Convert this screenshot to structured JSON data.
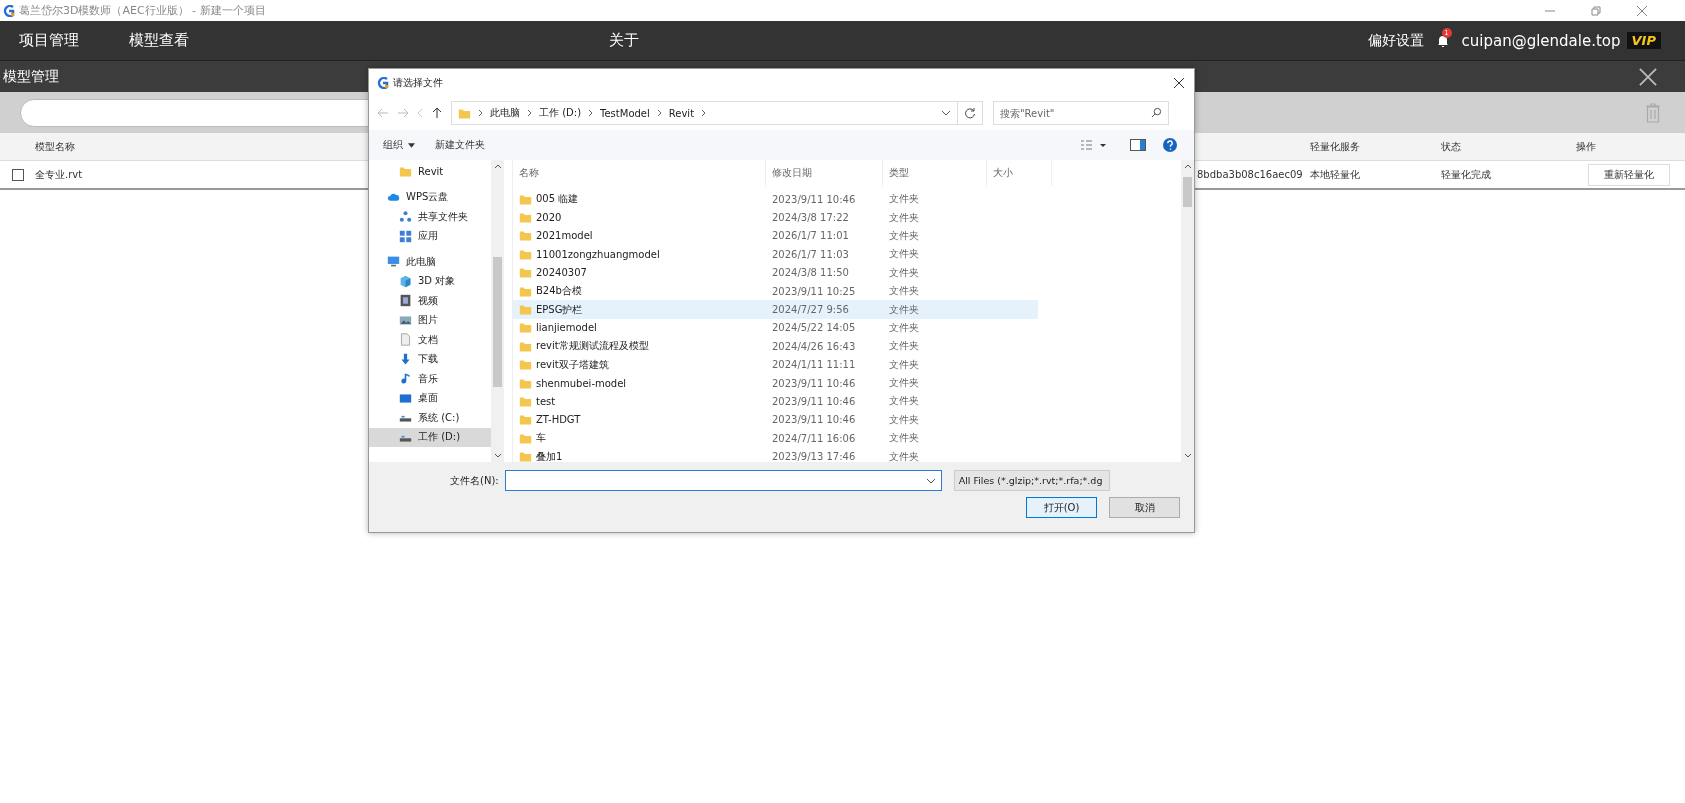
{
  "window": {
    "title": "葛兰岱尔3D模数师（AEC行业版） - 新建一个项目"
  },
  "menu": {
    "items": [
      {
        "label": "项目管理"
      },
      {
        "label": "模型查看"
      },
      {
        "label": "关于"
      }
    ],
    "preferences": "偏好设置",
    "notifications": "1",
    "user": "cuipan@glendale.top",
    "badge": "VIP"
  },
  "panel": {
    "title": "模型管理"
  },
  "table": {
    "columns": [
      "模型名称",
      "轻量化服务",
      "状态",
      "操作"
    ],
    "rows": [
      {
        "checked": false,
        "name": "全专业.rvt",
        "column_2": "8bdba3b08c16aec09",
        "service": "本地轻量化",
        "status": "轻量化完成",
        "action": "重新轻量化"
      }
    ]
  },
  "dialog": {
    "title": "请选择文件",
    "breadcrumb": [
      "此电脑",
      "工作 (D:)",
      "TestModel",
      "Revit"
    ],
    "search": {
      "placeholder": "搜索\"Revit\""
    },
    "toolbar": {
      "organize": "组织",
      "new_folder": "新建文件夹"
    },
    "nav": [
      {
        "children": [
          {
            "label": "Revit",
            "selected": false
          }
        ]
      },
      {
        "label": "WPS云盘",
        "selected": false,
        "children": [
          {
            "label": "共享文件夹",
            "selected": false
          },
          {
            "label": "应用",
            "selected": false
          }
        ]
      },
      {
        "label": "此电脑",
        "selected": false,
        "children": [
          {
            "label": "3D 对象",
            "selected": false
          },
          {
            "label": "视频",
            "selected": false
          },
          {
            "label": "图片",
            "selected": false
          },
          {
            "label": "文档",
            "selected": false
          },
          {
            "label": "下载",
            "selected": false
          },
          {
            "label": "音乐",
            "selected": false
          },
          {
            "label": "桌面",
            "selected": false
          },
          {
            "label": "系统 (C:)",
            "selected": false
          },
          {
            "label": "工作 (D:)",
            "selected": true
          }
        ]
      }
    ],
    "columns": [
      "名称",
      "修改日期",
      "类型",
      "大小"
    ],
    "files": [
      {
        "name": "005 临建",
        "date": "2023/9/11 10:46",
        "type": "文件夹",
        "selected": false
      },
      {
        "name": "2020",
        "date": "2024/3/8 17:22",
        "type": "文件夹",
        "selected": false
      },
      {
        "name": "2021model",
        "date": "2026/1/7 11:01",
        "type": "文件夹",
        "selected": false
      },
      {
        "name": "11001zongzhuangmodel",
        "date": "2026/1/7 11:03",
        "type": "文件夹",
        "selected": false
      },
      {
        "name": "20240307",
        "date": "2024/3/8 11:50",
        "type": "文件夹",
        "selected": false
      },
      {
        "name": "B24b合模",
        "date": "2023/9/11 10:25",
        "type": "文件夹",
        "selected": false
      },
      {
        "name": "EPSG护栏",
        "date": "2024/7/27 9:56",
        "type": "文件夹",
        "selected": true
      },
      {
        "name": "lianjiemodel",
        "date": "2024/5/22 14:05",
        "type": "文件夹",
        "selected": false
      },
      {
        "name": "revit常规测试流程及模型",
        "date": "2024/4/26 16:43",
        "type": "文件夹",
        "selected": false
      },
      {
        "name": "revit双子塔建筑",
        "date": "2024/1/11 11:11",
        "type": "文件夹",
        "selected": false
      },
      {
        "name": "shenmubei-model",
        "date": "2023/9/11 10:46",
        "type": "文件夹",
        "selected": false
      },
      {
        "name": "test",
        "date": "2023/9/11 10:46",
        "type": "文件夹",
        "selected": false
      },
      {
        "name": "ZT-HDGT",
        "date": "2023/9/11 10:46",
        "type": "文件夹",
        "selected": false
      },
      {
        "name": "车",
        "date": "2024/7/11 16:06",
        "type": "文件夹",
        "selected": false
      },
      {
        "name": "叠加1",
        "date": "2023/9/13 17:46",
        "type": "文件夹",
        "selected": false
      }
    ],
    "filename": {
      "label": "文件名(N):"
    },
    "filter": "All Files (*.glzip;*.rvt;*.rfa;*.dg",
    "buttons": [
      {
        "label": "打开(O)",
        "kind": "primary"
      },
      {
        "label": "取消",
        "kind": "normal"
      }
    ]
  }
}
